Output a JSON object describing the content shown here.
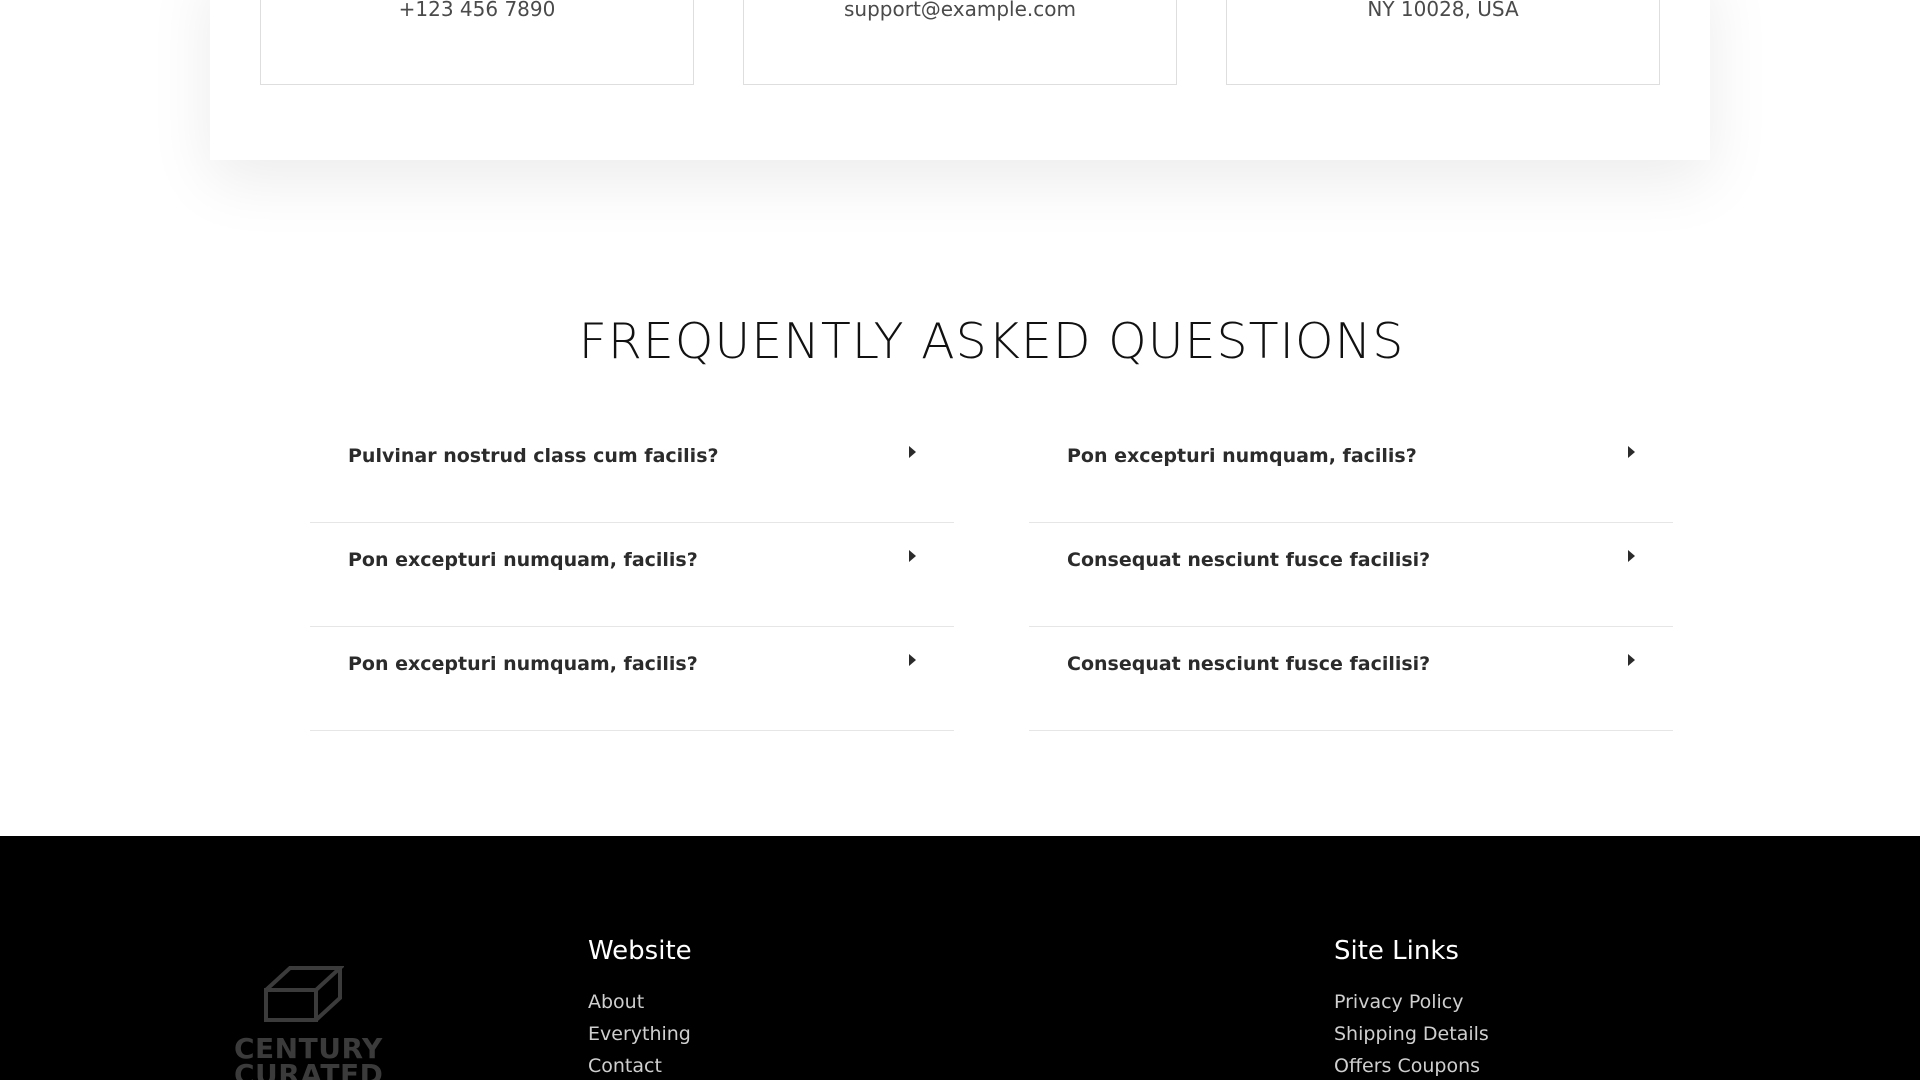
{
  "contact": {
    "phone": "+123 456 7890",
    "email": "support@example.com",
    "address": "NY 10028, USA"
  },
  "faq": {
    "title": "FREQUENTLY ASKED QUESTIONS",
    "left": [
      {
        "question": "Pulvinar nostrud class cum facilis?"
      },
      {
        "question": "Pon excepturi numquam, facilis?"
      },
      {
        "question": "Pon excepturi numquam, facilis?"
      }
    ],
    "right": [
      {
        "question": "Pon excepturi numquam, facilis?"
      },
      {
        "question": "Consequat nesciunt fusce facilisi?"
      },
      {
        "question": "Consequat nesciunt fusce facilisi?"
      }
    ],
    "caret_icon": "caret-right-icon"
  },
  "footer": {
    "logo_line1": "CENTURY",
    "logo_line2": "CURATED",
    "website": {
      "heading": "Website",
      "links": [
        "About",
        "Everything",
        "Contact"
      ]
    },
    "site_links": {
      "heading": "Site Links",
      "links": [
        "Privacy Policy",
        "Shipping Details",
        "Offers Coupons"
      ]
    }
  },
  "colors": {
    "footer_bg": "#000000",
    "heading_text": "#111111",
    "body_text": "#2b2b2b"
  }
}
